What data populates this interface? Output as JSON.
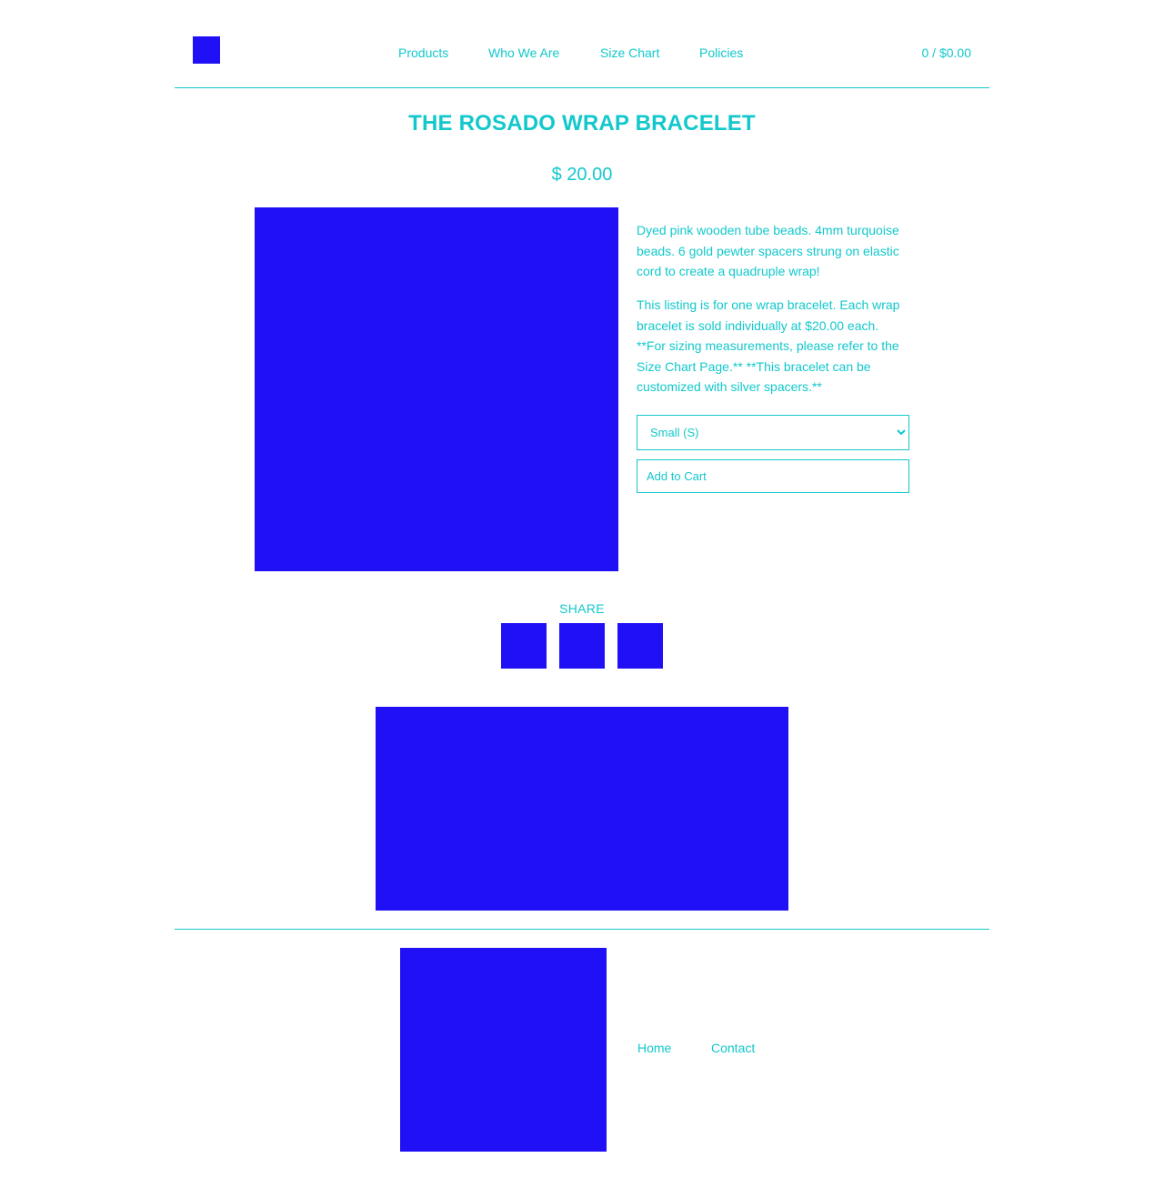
{
  "header": {
    "nav": [
      {
        "label": "Products"
      },
      {
        "label": "Who We Are"
      },
      {
        "label": "Size Chart"
      },
      {
        "label": "Policies"
      }
    ],
    "cart": "0 / $0.00"
  },
  "product": {
    "title": "THE ROSADO WRAP BRACELET",
    "price": "$ 20.00",
    "description_1": "Dyed pink wooden tube beads. 4mm turquoise beads. 6 gold pewter spacers strung on elastic cord to create a quadruple wrap!",
    "description_2": "This listing is for one wrap bracelet. Each wrap bracelet is sold individually at $20.00 each. **For sizing measurements, please refer to the Size Chart Page.** **This bracelet can be customized with silver spacers.**",
    "option_selected": "Small (S)",
    "add_to_cart": "Add to Cart"
  },
  "share": {
    "label": "SHARE"
  },
  "footer": {
    "links": [
      {
        "label": "Home"
      },
      {
        "label": "Contact"
      }
    ]
  },
  "colors": {
    "accent": "#12c8cc",
    "placeholder_block": "#1f10f5",
    "background": "#ffffff"
  }
}
